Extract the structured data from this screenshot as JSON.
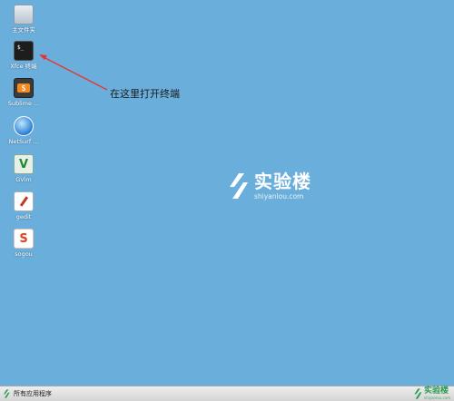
{
  "desktop": {
    "background_color": "#6aaedc",
    "icons": [
      {
        "label": "主文件夹",
        "icon": "folder-icon"
      },
      {
        "label": "Xfce 终端",
        "icon": "terminal-icon",
        "glyph": "$_"
      },
      {
        "label": "Sublime ...",
        "icon": "sublime-icon",
        "glyph": "S"
      },
      {
        "label": "NetSurf ...",
        "icon": "globe-icon"
      },
      {
        "label": "GVim",
        "icon": "vim-icon",
        "glyph": "V"
      },
      {
        "label": "gedit",
        "icon": "pen-icon"
      },
      {
        "label": "sogou",
        "icon": "sogou-icon",
        "glyph": "S"
      }
    ]
  },
  "annotation": {
    "text": "在这里打开终端",
    "arrow_color": "#e8352f"
  },
  "watermark": {
    "title": "实验楼",
    "subtitle": "shiyanlou.com"
  },
  "taskbar": {
    "start_label": "所有应用程序",
    "tray_title": "实验楼",
    "tray_subtitle": "shiyanlou.com",
    "brand_color": "#2a9a4e"
  }
}
